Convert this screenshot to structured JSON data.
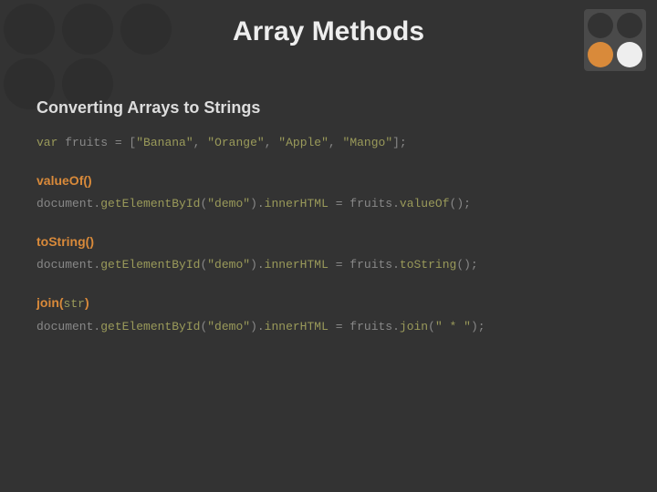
{
  "title": "Array Methods",
  "subtitle": "Converting Arrays to Strings",
  "declLine": {
    "kw": "var",
    "name": " fruits = [",
    "s1": "\"Banana\"",
    "s2": "\"Orange\"",
    "s3": "\"Apple\"",
    "s4": "\"Mango\"",
    "end": "];"
  },
  "methods": {
    "valueOf": {
      "name": "valueOf()",
      "pre": "document.",
      "m1": "getElementById",
      "p1": "(",
      "arg": "\"demo\"",
      "p2": ").",
      "m2": "innerHTML",
      "mid": " = fruits.",
      "m3": "valueOf",
      "post": "();"
    },
    "toString": {
      "name": "toString()",
      "pre": "document.",
      "m1": "getElementById",
      "p1": "(",
      "arg": "\"demo\"",
      "p2": ").",
      "m2": "innerHTML",
      "mid": " = fruits.",
      "m3": "toString",
      "post": "();"
    },
    "join": {
      "nameA": "join(",
      "nameArg": "str",
      "nameB": ")",
      "pre": "document.",
      "m1": "getElementById",
      "p1": "(",
      "arg": "\"demo\"",
      "p2": ").",
      "m2": "innerHTML",
      "mid": " = fruits.",
      "m3": "join",
      "p3": "(",
      "jarg": "\" * \"",
      "post": ");"
    }
  }
}
